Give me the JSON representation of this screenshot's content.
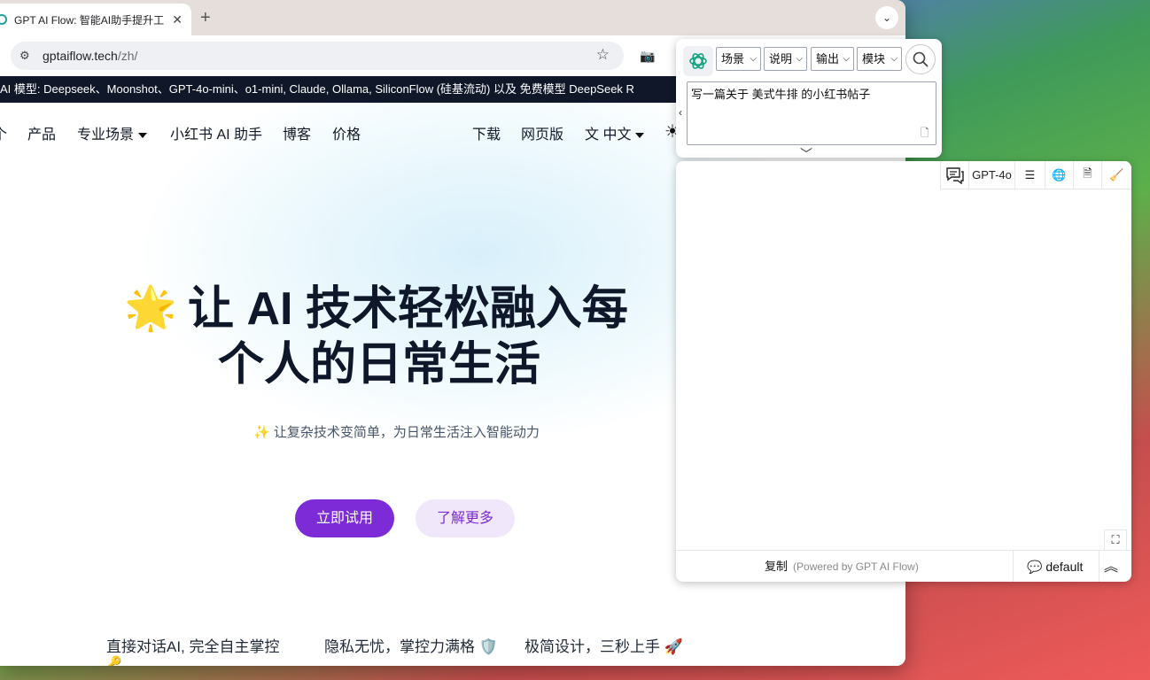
{
  "browser": {
    "tab_title": "GPT AI Flow: 智能AI助手提升工",
    "tab_close": "✕",
    "new_tab": "+",
    "tab_menu": "⌄",
    "url_host": "gptaiflow.tech",
    "url_path": "/zh/"
  },
  "banner": {
    "text": "AI 模型: Deepseek、Moonshot、GPT-4o-mini、o1-mini, Claude, Ollama, SiliconFlow (硅基流动) 以及 免费模型 DeepSeek R"
  },
  "nav": {
    "partial": "个",
    "products": "产品",
    "scenarios": "专业场景",
    "xiaohongshu": "小红书 AI 助手",
    "blog": "博客",
    "pricing": "价格",
    "download": "下载",
    "web": "网页版",
    "language": "中文"
  },
  "hero": {
    "emoji": "🌟",
    "line1": "让 AI 技术轻松融入每",
    "line2": "个人的日常生活",
    "subtitle": "✨ 让复杂技术变简单，为日常生活注入智能动力",
    "cta_primary": "立即试用",
    "cta_secondary": "了解更多"
  },
  "features": [
    "直接对话AI, 完全自主掌控",
    "隐私无忧，掌控力满格 🛡️",
    "极简设计，三秒上手 🚀"
  ],
  "feature_key_emoji": "🔑",
  "extension": {
    "dropdowns": [
      "场景",
      "说明",
      "输出",
      "模块"
    ],
    "prompt_value": "写一篇关于 美式牛排 的小红书帖子",
    "model_label": "GPT-4o",
    "copy_label": "复制",
    "powered_by": "(Powered by GPT AI Flow)",
    "persona": "default"
  },
  "colors": {
    "accent": "#7c2bd6",
    "accent_light": "#f1e7fb",
    "banner_bg": "#0f1728"
  }
}
